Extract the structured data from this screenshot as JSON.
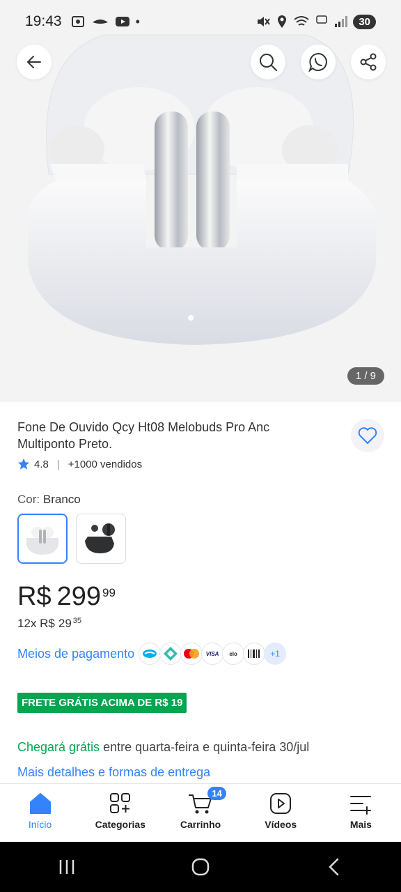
{
  "status_bar": {
    "time": "19:43",
    "battery": "30"
  },
  "hero": {
    "counter": "1 / 9"
  },
  "product": {
    "title": "Fone De Ouvido Qcy Ht08 Melobuds Pro Anc Multiponto Preto.",
    "rating": "4.8",
    "sold": "+1000 vendidos",
    "color_label": "Cor:",
    "color_value": "Branco",
    "price_currency": "R$",
    "price_int": "299",
    "price_cents": "99",
    "installments_prefix": "12x R$",
    "installments_int": "29",
    "installments_cents": "35",
    "payment_link": "Meios de pagamento",
    "payment_more": "+1",
    "payment_icons": [
      "mercado-pago",
      "pix",
      "mastercard",
      "visa",
      "elo",
      "boleto"
    ],
    "free_shipping_badge": "FRETE GRÁTIS ACIMA DE R$ 19",
    "delivery_highlight": "Chegará grátis",
    "delivery_text": " entre quarta-feira e quinta-feira 30/jul",
    "delivery_more": "Mais detalhes e formas de entrega"
  },
  "nav": {
    "items": [
      {
        "label": "Início",
        "icon": "home-icon",
        "active": true
      },
      {
        "label": "Categorias",
        "icon": "categories-icon"
      },
      {
        "label": "Carrinho",
        "icon": "cart-icon",
        "badge": "14"
      },
      {
        "label": "Vídeos",
        "icon": "video-icon"
      },
      {
        "label": "Mais",
        "icon": "menu-plus-icon"
      }
    ]
  },
  "colors": {
    "accent": "#3483fa",
    "green": "#00a650"
  }
}
